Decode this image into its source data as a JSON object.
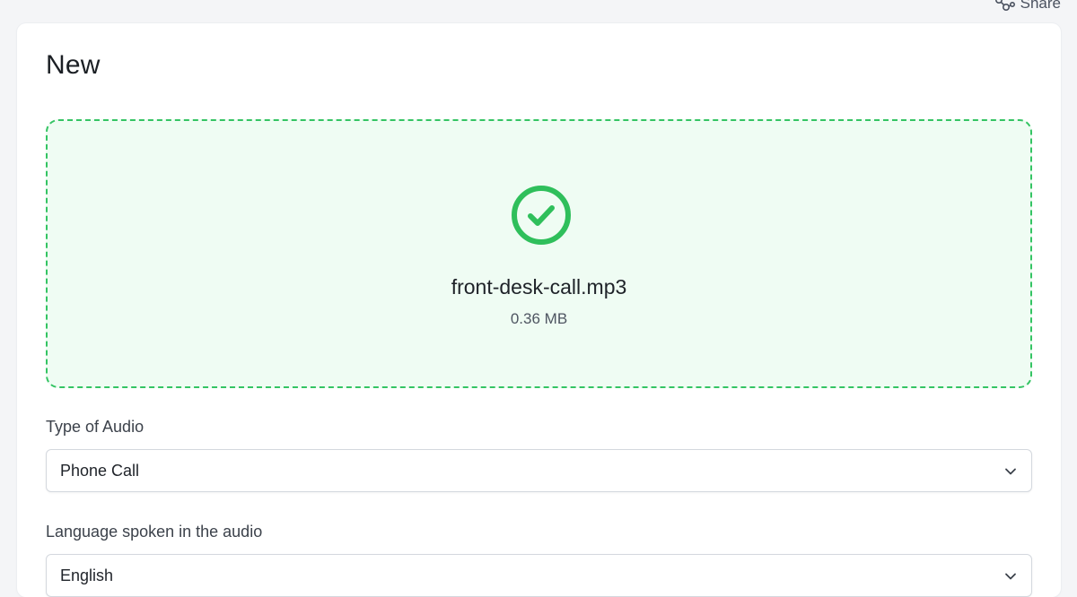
{
  "header": {
    "share_label": "Share",
    "share_icon": "share-icon"
  },
  "page": {
    "title": "New"
  },
  "upload": {
    "status_icon": "check-circle-icon",
    "file_name": "front-desk-call.mp3",
    "file_size": "0.36 MB",
    "accent_color": "#2fbf5b",
    "background_color": "#effcf3"
  },
  "form": {
    "audio_type": {
      "label": "Type of Audio",
      "selected": "Phone Call",
      "icon": "chevron-down-icon"
    },
    "language": {
      "label": "Language spoken in the audio",
      "selected": "English",
      "icon": "chevron-down-icon"
    }
  }
}
